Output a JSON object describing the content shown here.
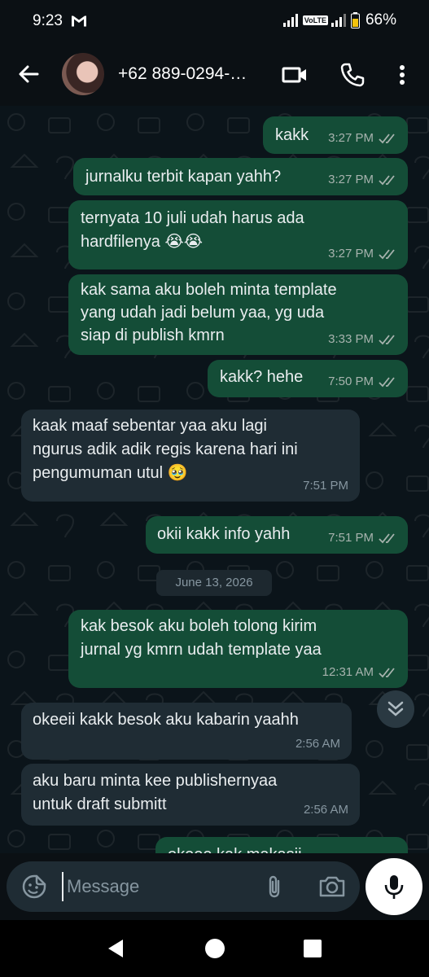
{
  "status_bar": {
    "time": "9:23",
    "volte": "VoLTE",
    "battery": "66%"
  },
  "header": {
    "contact_name": "+62 889-0294-…"
  },
  "icons": {
    "back": "arrow-left-icon",
    "video": "video-call-icon",
    "call": "phone-icon",
    "menu": "more-vertical-icon",
    "emoji": "sticker-icon",
    "attach": "paperclip-icon",
    "camera": "camera-icon",
    "mic": "microphone-icon"
  },
  "colors": {
    "outgoing_bubble": "#144d37",
    "incoming_bubble": "#1f2c34",
    "background": "#0b141a",
    "ticks": "#a7b3ae"
  },
  "messages": [
    {
      "direction": "out",
      "text": "kakk",
      "time": "3:27 PM"
    },
    {
      "direction": "out",
      "text": "jurnalku terbit kapan yahh?",
      "time": "3:27 PM"
    },
    {
      "direction": "out",
      "text": "ternyata 10 juli udah harus ada\nhardfilenya 😭😭",
      "time": "3:27 PM"
    },
    {
      "direction": "out",
      "text": "kak sama aku boleh minta template\nyang udah jadi belum yaa, yg uda\nsiap di publish kmrn",
      "time": "3:33 PM"
    },
    {
      "direction": "out",
      "text": "kakk? hehe",
      "time": "7:50 PM"
    },
    {
      "direction": "in",
      "text": "kaak maaf sebentar yaa aku lagi\nngurus adik adik regis karena hari ini\npengumuman utul 🥹",
      "time": "7:51 PM"
    },
    {
      "direction": "out",
      "text": "okii kakk info yahh",
      "time": "7:51 PM"
    },
    {
      "direction": "out",
      "text": "kak besok aku boleh tolong kirim\njurnal yg kmrn udah template yaa",
      "time": "12:31 AM"
    },
    {
      "direction": "in",
      "text": "okeeii kakk besok aku kabarin yaahh",
      "time": "2:56 AM"
    },
    {
      "direction": "in",
      "text": "aku baru minta kee publishernyaa\nuntuk draft submitt",
      "time": "2:56 AM"
    },
    {
      "direction": "out",
      "text": "okeee kak makasii",
      "time": ""
    }
  ],
  "date_separator": "June 13, 2026",
  "input": {
    "placeholder": "Message"
  }
}
